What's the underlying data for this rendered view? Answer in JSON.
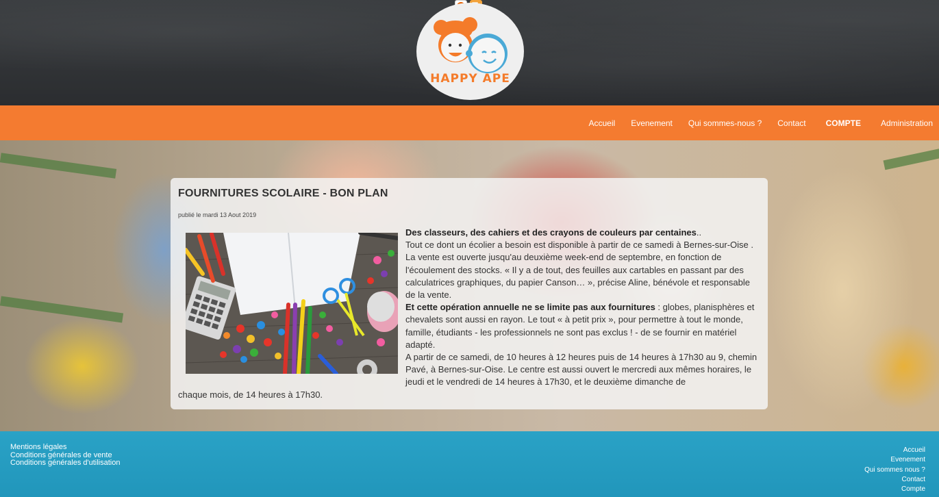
{
  "logo": {
    "text": "HAPPY APE"
  },
  "nav": {
    "items": [
      {
        "label": "Accueil",
        "bold": false
      },
      {
        "label": "Evenement",
        "bold": false
      },
      {
        "label": "Qui sommes-nous ?",
        "bold": false
      },
      {
        "label": "Contact",
        "bold": false
      },
      {
        "label": "COMPTE",
        "bold": true
      },
      {
        "label": "Administration",
        "bold": false
      }
    ]
  },
  "article": {
    "title": "FOURNITURES SCOLAIRE - BON PLAN",
    "date": "publié le mardi 13 Aout 2019",
    "p1_bold": "Des classeurs, des cahiers et des crayons de couleurs par centaines",
    "p1_rest": "..",
    "p2": "Tout ce dont un écolier a besoin est disponible à partir de ce samedi à Bernes-sur-Oise . La vente est ouverte jusqu'au deuxième week-end de septembre, en fonction de l'écoulement des stocks. « Il y a de tout, des feuilles aux cartables en passant par des calculatrices graphiques, du papier Canson… », précise Aline, bénévole et responsable de la vente.",
    "p3_bold": "Et cette opération annuelle ne se limite pas aux fournitures",
    "p3_rest": " : globes, planisphères et chevalets sont aussi en rayon. Le tout « à petit prix », pour permettre à tout le monde, famille, étudiants - les professionnels ne sont pas exclus ! - de se fournir en matériel adapté.",
    "p4": "A partir de ce samedi, de 10 heures à 12 heures puis de 14 heures à 17h30 au 9, chemin Pavé, à Bernes-sur-Oise. Le centre est aussi ouvert le mercredi aux mêmes horaires, le jeudi et le vendredi de 14 heures à 17h30, et le deuxième dimanche de",
    "p4_tail": "chaque mois, de 14 heures à 17h30."
  },
  "footer": {
    "left": [
      "Mentions légales",
      "Conditions générales de vente",
      "Conditions générales d'utilisation"
    ],
    "right": [
      "Accueil",
      "Evenement",
      "Qui sommes nous ?",
      "Contact",
      "Compte"
    ]
  },
  "colors": {
    "nav": "#f47b30",
    "footer": "#2aa2c6",
    "logo_text": "#f47b2a"
  }
}
